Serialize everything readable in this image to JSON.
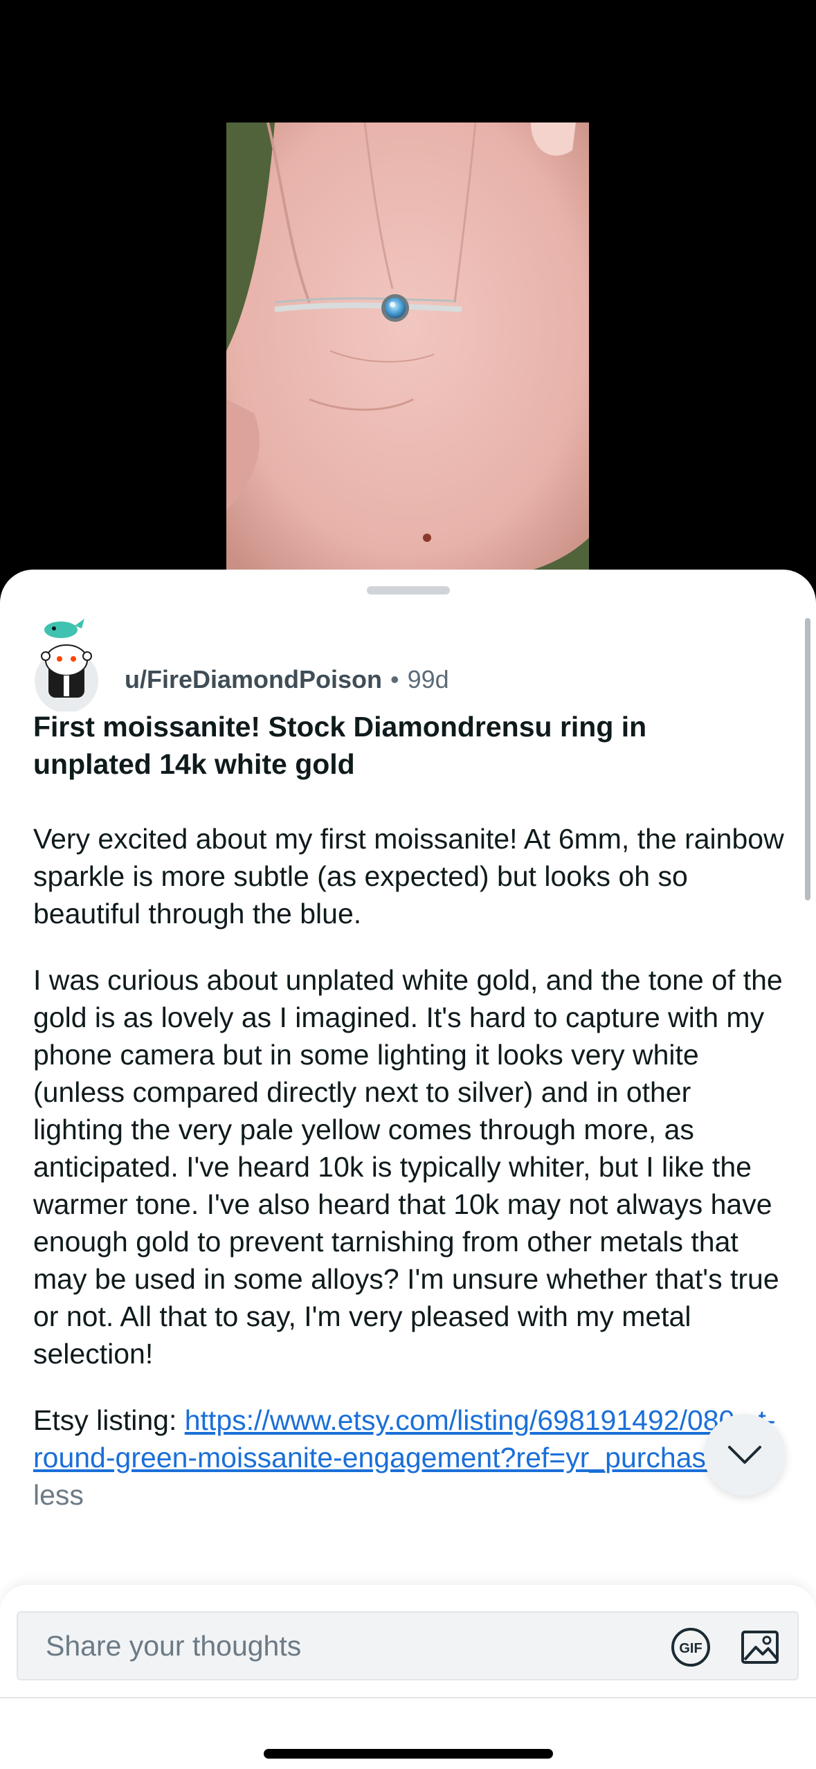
{
  "post": {
    "author": "u/FireDiamondPoison",
    "separator": "•",
    "age": "99d",
    "title": "First moissanite! Stock Diamondrensu ring in unplated 14k white gold",
    "body_p1": "Very excited about my first moissanite! At 6mm, the rainbow sparkle is more subtle (as expected) but looks oh so beautiful through the blue.",
    "body_p2": "I was curious about unplated white gold, and the tone of the gold is as lovely as I imagined. It's hard to capture with my phone camera but in some lighting it looks very white (unless compared directly next to silver) and in other lighting the very pale yellow comes through more, as anticipated. I've heard 10k is typically whiter, but I like the warmer tone. I've also heard that 10k may not always have enough gold to prevent tarnishing from other metals that may be used in some alloys? I'm unsure whether that's true or not. All that to say, I'm very pleased with my metal selection!",
    "etsy_label": "Etsy listing: ",
    "etsy_link": "https://www.etsy.com/listing/698191492/080-ct-round-green-moissanite-engagement?ref=yr_purchases",
    "less_label": " less"
  },
  "composer": {
    "placeholder": "Share your thoughts",
    "gif_label": "GIF"
  },
  "colors": {
    "link": "#1a6fd8",
    "text": "#0f1a1c",
    "muted": "#5c6b76"
  },
  "icons": {
    "scroll": "chevron-down-icon",
    "image": "image-icon",
    "gif": "gif-icon"
  }
}
